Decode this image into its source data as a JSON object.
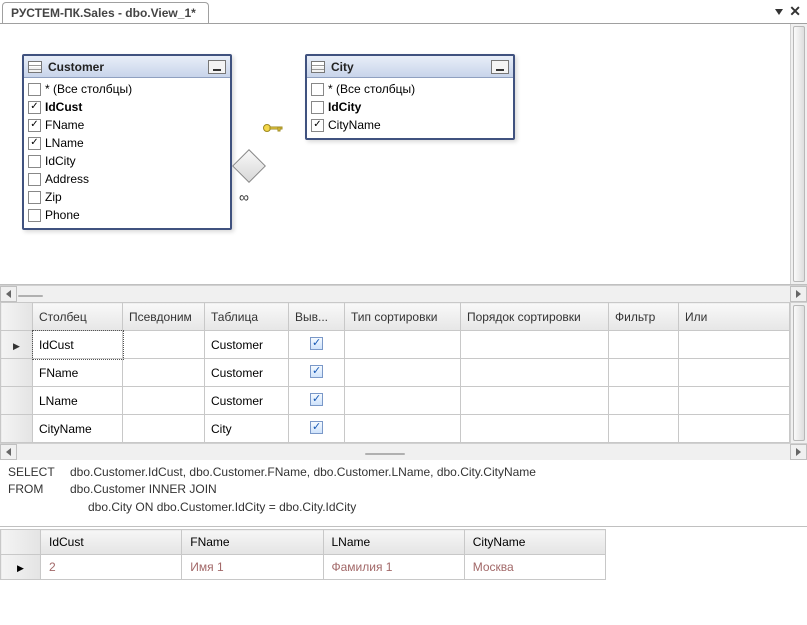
{
  "tab": {
    "title": "РУСТЕМ-ПК.Sales - dbo.View_1*"
  },
  "diagram": {
    "tables": {
      "customer": {
        "title": "Customer",
        "cols": [
          {
            "label": "* (Все столбцы)",
            "checked": false,
            "bold": false
          },
          {
            "label": "IdCust",
            "checked": true,
            "bold": true
          },
          {
            "label": "FName",
            "checked": true,
            "bold": false
          },
          {
            "label": "LName",
            "checked": true,
            "bold": false
          },
          {
            "label": "IdCity",
            "checked": false,
            "bold": false
          },
          {
            "label": "Address",
            "checked": false,
            "bold": false
          },
          {
            "label": "Zip",
            "checked": false,
            "bold": false
          },
          {
            "label": "Phone",
            "checked": false,
            "bold": false
          }
        ]
      },
      "city": {
        "title": "City",
        "cols": [
          {
            "label": "* (Все столбцы)",
            "checked": false,
            "bold": false
          },
          {
            "label": "IdCity",
            "checked": false,
            "bold": true
          },
          {
            "label": "CityName",
            "checked": true,
            "bold": false
          }
        ]
      }
    }
  },
  "criteria": {
    "headers": {
      "col": "Столбец",
      "alias": "Псевдоним",
      "table": "Таблица",
      "out": "Выв...",
      "sortt": "Тип сортировки",
      "sorto": "Порядок сортировки",
      "filt": "Фильтр",
      "or": "Или"
    },
    "rows": [
      {
        "col": "IdCust",
        "table": "Customer"
      },
      {
        "col": "FName",
        "table": "Customer"
      },
      {
        "col": "LName",
        "table": "Customer"
      },
      {
        "col": "CityName",
        "table": "City"
      }
    ]
  },
  "sql": {
    "select_kw": "SELECT",
    "select_body": "dbo.Customer.IdCust, dbo.Customer.FName, dbo.Customer.LName, dbo.City.CityName",
    "from_kw": "FROM",
    "from_body": "dbo.Customer INNER JOIN",
    "join_body": "dbo.City ON dbo.Customer.IdCity = dbo.City.IdCity"
  },
  "results": {
    "headers": {
      "c0": "IdCust",
      "c1": "FName",
      "c2": "LName",
      "c3": "CityName"
    },
    "rows": [
      {
        "c0": "2",
        "c1": "Имя 1",
        "c2": "Фамилия 1",
        "c3": "Москва"
      }
    ]
  }
}
